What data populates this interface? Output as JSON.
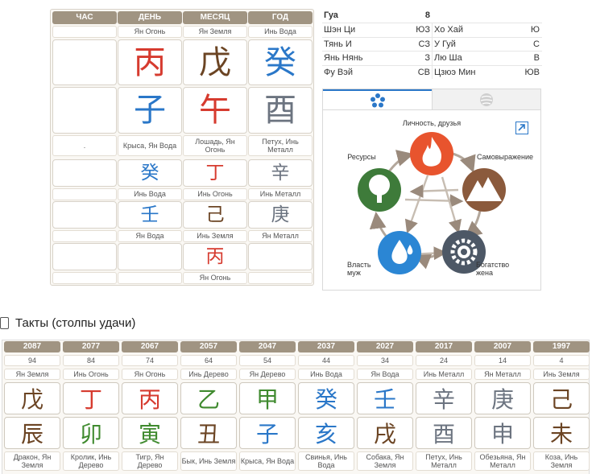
{
  "chart": {
    "headers": [
      "ЧАС",
      "ДЕНЬ",
      "МЕСЯЦ",
      "ГОД"
    ],
    "stem_labels": [
      "",
      "Ян Огонь",
      "Ян Земля",
      "Инь Вода"
    ],
    "stems": [
      {
        "char": "",
        "color": "#000000"
      },
      {
        "char": "丙",
        "color": "#d63b2f"
      },
      {
        "char": "戊",
        "color": "#6b4423"
      },
      {
        "char": "癸",
        "color": "#2a77c8"
      }
    ],
    "branches": [
      {
        "char": "",
        "color": "#000000"
      },
      {
        "char": "子",
        "color": "#2a77c8"
      },
      {
        "char": "午",
        "color": "#d63b2f"
      },
      {
        "char": "酉",
        "color": "#6c7480"
      }
    ],
    "branch_labels": [
      ".",
      "Крыса, Ян Вода",
      "Лошадь, Ян Огонь",
      "Петух, Инь Металл"
    ],
    "hidden": [
      [
        {
          "char": "",
          "color": "#000000",
          "label": ""
        },
        {
          "char": "癸",
          "color": "#2a77c8",
          "label": "Инь Вода"
        },
        {
          "char": "丁",
          "color": "#d63b2f",
          "label": "Инь Огонь"
        },
        {
          "char": "辛",
          "color": "#6c7480",
          "label": "Инь Металл"
        }
      ],
      [
        {
          "char": "",
          "color": "#000000",
          "label": ""
        },
        {
          "char": "壬",
          "color": "#2a77c8",
          "label": "Ян Вода"
        },
        {
          "char": "己",
          "color": "#6b4423",
          "label": "Инь Земля"
        },
        {
          "char": "庚",
          "color": "#6c7480",
          "label": "Ян Металл"
        }
      ],
      [
        {
          "char": "",
          "color": "#000000",
          "label": ""
        },
        {
          "char": "",
          "color": "#000000",
          "label": ""
        },
        {
          "char": "丙",
          "color": "#d63b2f",
          "label": "Ян Огонь"
        },
        {
          "char": "",
          "color": "#000000",
          "label": ""
        }
      ]
    ]
  },
  "info": {
    "gua_label": "Гуа",
    "gua_value": "8",
    "rows": [
      [
        [
          "Шэн Ци",
          "ЮЗ"
        ],
        [
          "Хо Хай",
          "Ю"
        ]
      ],
      [
        [
          "Тянь И",
          "СЗ"
        ],
        [
          "У Гуй",
          "С"
        ]
      ],
      [
        [
          "Янь Нянь",
          "З"
        ],
        [
          "Лю Ша",
          "В"
        ]
      ],
      [
        [
          "Фу Вэй",
          "СВ"
        ],
        [
          "Цзюэ Мин",
          "ЮВ"
        ]
      ]
    ]
  },
  "elements": {
    "labels": {
      "personality": "Личность, друзья",
      "expression": "Самовыражение",
      "wealth": "Богатство жена",
      "power": "Власть муж",
      "resources": "Ресурсы"
    },
    "icons": [
      "pentagon-flower-icon",
      "globe-icon",
      "expand-icon",
      "fire-icon",
      "mountain-icon",
      "gear-icon",
      "water-drops-icon",
      "tree-icon"
    ],
    "colors": {
      "fire": "#e8542e",
      "earth": "#8b5a3c",
      "metal": "#4d5866",
      "water": "#2b86d4",
      "wood": "#3e7b3a"
    }
  },
  "luck": {
    "title": "Такты (столпы удачи)",
    "pillars": [
      {
        "year": "2087",
        "age": "94",
        "stem_label": "Ян Земля",
        "stem": "戊",
        "stem_color": "#6b4423",
        "branch": "辰",
        "branch_color": "#6b4423",
        "branch_label": "Дракон, Ян Земля"
      },
      {
        "year": "2077",
        "age": "84",
        "stem_label": "Инь Огонь",
        "stem": "丁",
        "stem_color": "#d63b2f",
        "branch": "卯",
        "branch_color": "#3f8a2e",
        "branch_label": "Кролик, Инь Дерево"
      },
      {
        "year": "2067",
        "age": "74",
        "stem_label": "Ян Огонь",
        "stem": "丙",
        "stem_color": "#d63b2f",
        "branch": "寅",
        "branch_color": "#3f8a2e",
        "branch_label": "Тигр, Ян Дерево"
      },
      {
        "year": "2057",
        "age": "64",
        "stem_label": "Инь Дерево",
        "stem": "乙",
        "stem_color": "#3f8a2e",
        "branch": "丑",
        "branch_color": "#6b4423",
        "branch_label": "Бык, Инь Земля"
      },
      {
        "year": "2047",
        "age": "54",
        "stem_label": "Ян Дерево",
        "stem": "甲",
        "stem_color": "#3f8a2e",
        "branch": "子",
        "branch_color": "#2a77c8",
        "branch_label": "Крыса, Ян Вода"
      },
      {
        "year": "2037",
        "age": "44",
        "stem_label": "Инь Вода",
        "stem": "癸",
        "stem_color": "#2a77c8",
        "branch": "亥",
        "branch_color": "#2a77c8",
        "branch_label": "Свинья, Инь Вода"
      },
      {
        "year": "2027",
        "age": "34",
        "stem_label": "Ян Вода",
        "stem": "壬",
        "stem_color": "#2a77c8",
        "branch": "戌",
        "branch_color": "#6b4423",
        "branch_label": "Собака, Ян Земля"
      },
      {
        "year": "2017",
        "age": "24",
        "stem_label": "Инь Металл",
        "stem": "辛",
        "stem_color": "#6c7480",
        "branch": "酉",
        "branch_color": "#6c7480",
        "branch_label": "Петух, Инь Металл"
      },
      {
        "year": "2007",
        "age": "14",
        "stem_label": "Ян Металл",
        "stem": "庚",
        "stem_color": "#6c7480",
        "branch": "申",
        "branch_color": "#6c7480",
        "branch_label": "Обезьяна, Ян Металл"
      },
      {
        "year": "1997",
        "age": "4",
        "stem_label": "Инь Земля",
        "stem": "己",
        "stem_color": "#6b4423",
        "branch": "未",
        "branch_color": "#6b4423",
        "branch_label": "Коза, Инь Земля"
      }
    ]
  }
}
